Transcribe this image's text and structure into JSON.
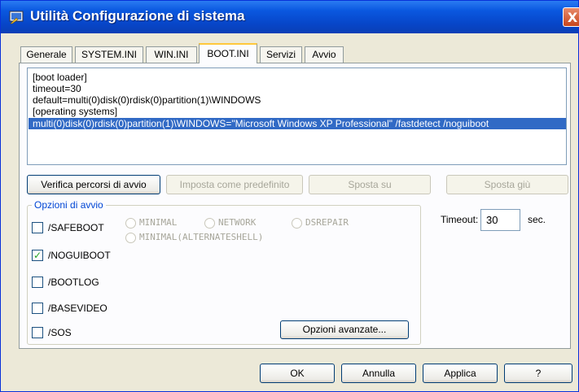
{
  "window": {
    "title": "Utilità Configurazione di sistema",
    "close_label": "X"
  },
  "tabs": [
    {
      "label": "Generale",
      "active": false
    },
    {
      "label": "SYSTEM.INI",
      "active": false
    },
    {
      "label": "WIN.INI",
      "active": false
    },
    {
      "label": "BOOT.INI",
      "active": true
    },
    {
      "label": "Servizi",
      "active": false
    },
    {
      "label": "Avvio",
      "active": false
    }
  ],
  "boot_ini": {
    "lines": [
      "[boot loader]",
      "timeout=30",
      "default=multi(0)disk(0)rdisk(0)partition(1)\\WINDOWS",
      "[operating systems]",
      "multi(0)disk(0)rdisk(0)partition(1)\\WINDOWS=\"Microsoft Windows XP Professional\" /fastdetect /noguiboot"
    ],
    "selected_index": 4
  },
  "buttons": {
    "verify": "Verifica percorsi di avvio",
    "set_default": "Imposta come predefinito",
    "move_up": "Sposta su",
    "move_down": "Sposta giù",
    "advanced": "Opzioni avanzate...",
    "ok": "OK",
    "cancel": "Annulla",
    "apply": "Applica",
    "help": "?"
  },
  "options": {
    "group_label": "Opzioni di avvio",
    "checkboxes": [
      {
        "label": "/SAFEBOOT",
        "checked": false
      },
      {
        "label": "/NOGUIBOOT",
        "checked": true
      },
      {
        "label": "/BOOTLOG",
        "checked": false
      },
      {
        "label": "/BASEVIDEO",
        "checked": false
      },
      {
        "label": "/SOS",
        "checked": false
      }
    ],
    "radios": [
      "MINIMAL",
      "NETWORK",
      "DSREPAIR",
      "MINIMAL(ALTERNATESHELL)"
    ],
    "check_mark": "✓"
  },
  "timeout": {
    "label": "Timeout:",
    "value": "30",
    "unit": "sec."
  },
  "colors": {
    "titlebar": "#0a58e0",
    "selection": "#316ac5",
    "group_label": "#0046d5",
    "check": "#21a121"
  }
}
